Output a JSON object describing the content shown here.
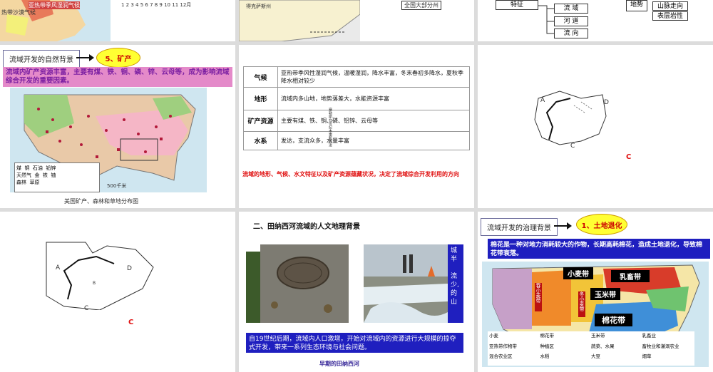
{
  "slide1": {
    "map_label_1": "热带沙漠气候",
    "map_label_2": "亚热带季风湿润气候",
    "month_axis": "1  2  3  4  5  6  7  8  9  10  11  12月"
  },
  "slide2": {
    "map_label": "得克萨斯州",
    "legend_text": "全国大部分州"
  },
  "slide3": {
    "left_label": "特征",
    "items": [
      "流  域",
      "河  道",
      "流  向"
    ],
    "right_label": "地势",
    "right_items": [
      "山脉走向",
      "表层岩性"
    ]
  },
  "slide4": {
    "tag": "流域开发的自然背景",
    "oval": "5、矿产",
    "band_text": "流域内矿产资源丰富，主要有煤、铁、铜、磷、锌、云母等，成为影响流域综合开发的重要因素。",
    "legend": [
      "煤",
      "铜",
      "石油",
      "铅锌",
      "天然气",
      "金",
      "铁",
      "铀",
      "森林",
      "草原"
    ],
    "scale": "500千米",
    "caption": "美国矿产、森林和草地分布图"
  },
  "slide5": {
    "rows": [
      {
        "k": "气候",
        "v": "亚热带季风性湿润气候，温暖湿润，降水丰富，冬末春初多降水，夏秋季降水相对较少"
      },
      {
        "k": "地形",
        "v": "流域内多山地，地势落差大，水能资源丰富"
      },
      {
        "k": "矿产资源",
        "v": "主要有煤、铁、铜、磷、铝锌、云母等"
      },
      {
        "k": "水系",
        "v": "发达，支流众多，水量丰富"
      }
    ],
    "vertical_note": "塞勒斯在世纪末重新疏浚",
    "conclusion": "流域的地形、气候、水文特征以及矿产资源蕴藏状况，决定了流域综合开发利用的方向"
  },
  "slide6": {
    "label_a": "A",
    "label_d": "D",
    "label_c": "C",
    "answer": "C"
  },
  "slide7": {
    "label_a": "A",
    "label_b": "B",
    "label_d": "D",
    "label_c": "C",
    "answer": "C"
  },
  "slide8": {
    "title": "二、田纳西河流域的人文地理背景",
    "side_text": "城\n半\n\n流\n少,\n的\n山",
    "bottom_text": "自19世纪后期，流域内人口激增，开始对流域内的资源进行大规模的掠夺式开发，带来一系列生态环境与社会问题。",
    "caption": "早期的田纳西河"
  },
  "slide9": {
    "tag": "流域开发的治理背景",
    "oval": "1、土地退化",
    "band_text": "棉花是一种对地力消耗较大的作物，长期高耗棉花，造成土地退化，导致棉花带衰落。",
    "belts": [
      "小麦带",
      "乳畜带",
      "玉米带",
      "棉花带",
      "春小麦带",
      "冬小麦带"
    ],
    "legend": [
      "小麦",
      "棉花带",
      "玉米带",
      "乳畜业",
      "亚热带作物带",
      "种植区",
      "蔬菜、水果",
      "畜牧业和灌溉农业",
      "混合农业区",
      "水稻",
      "大豆",
      "烟草"
    ]
  },
  "colors": {
    "accent_red": "#e01010",
    "tag_yellow": "#ffff33",
    "band_pink": "#e48ac9",
    "band_blue": "#1f1fbf"
  }
}
